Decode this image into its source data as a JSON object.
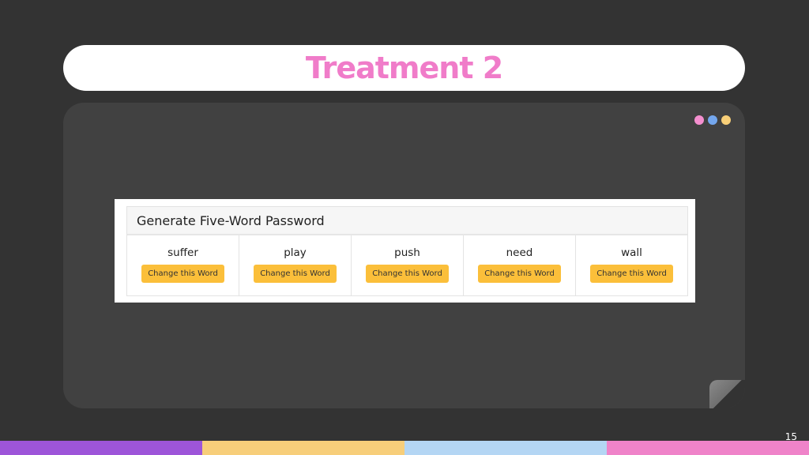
{
  "slide": {
    "title": "Treatment 2",
    "title_color": "#f07cc9",
    "page_number": "15"
  },
  "window_dots": [
    {
      "icon": "pink-dot-icon",
      "color": "#f48fcf"
    },
    {
      "icon": "blue-dot-icon",
      "color": "#74a7ee"
    },
    {
      "icon": "yellow-dot-icon",
      "color": "#f8cf78"
    }
  ],
  "accent_stripes": [
    "#9d55d9",
    "#f7ce7a",
    "#b4d6f4",
    "#ef83c9"
  ],
  "password_panel": {
    "header": "Generate Five-Word Password",
    "words": [
      {
        "word": "suffer",
        "button_label": "Change this Word"
      },
      {
        "word": "play",
        "button_label": "Change this Word"
      },
      {
        "word": "push",
        "button_label": "Change this Word"
      },
      {
        "word": "need",
        "button_label": "Change this Word"
      },
      {
        "word": "wall",
        "button_label": "Change this Word"
      }
    ],
    "button_color": "#fbbf3a"
  }
}
